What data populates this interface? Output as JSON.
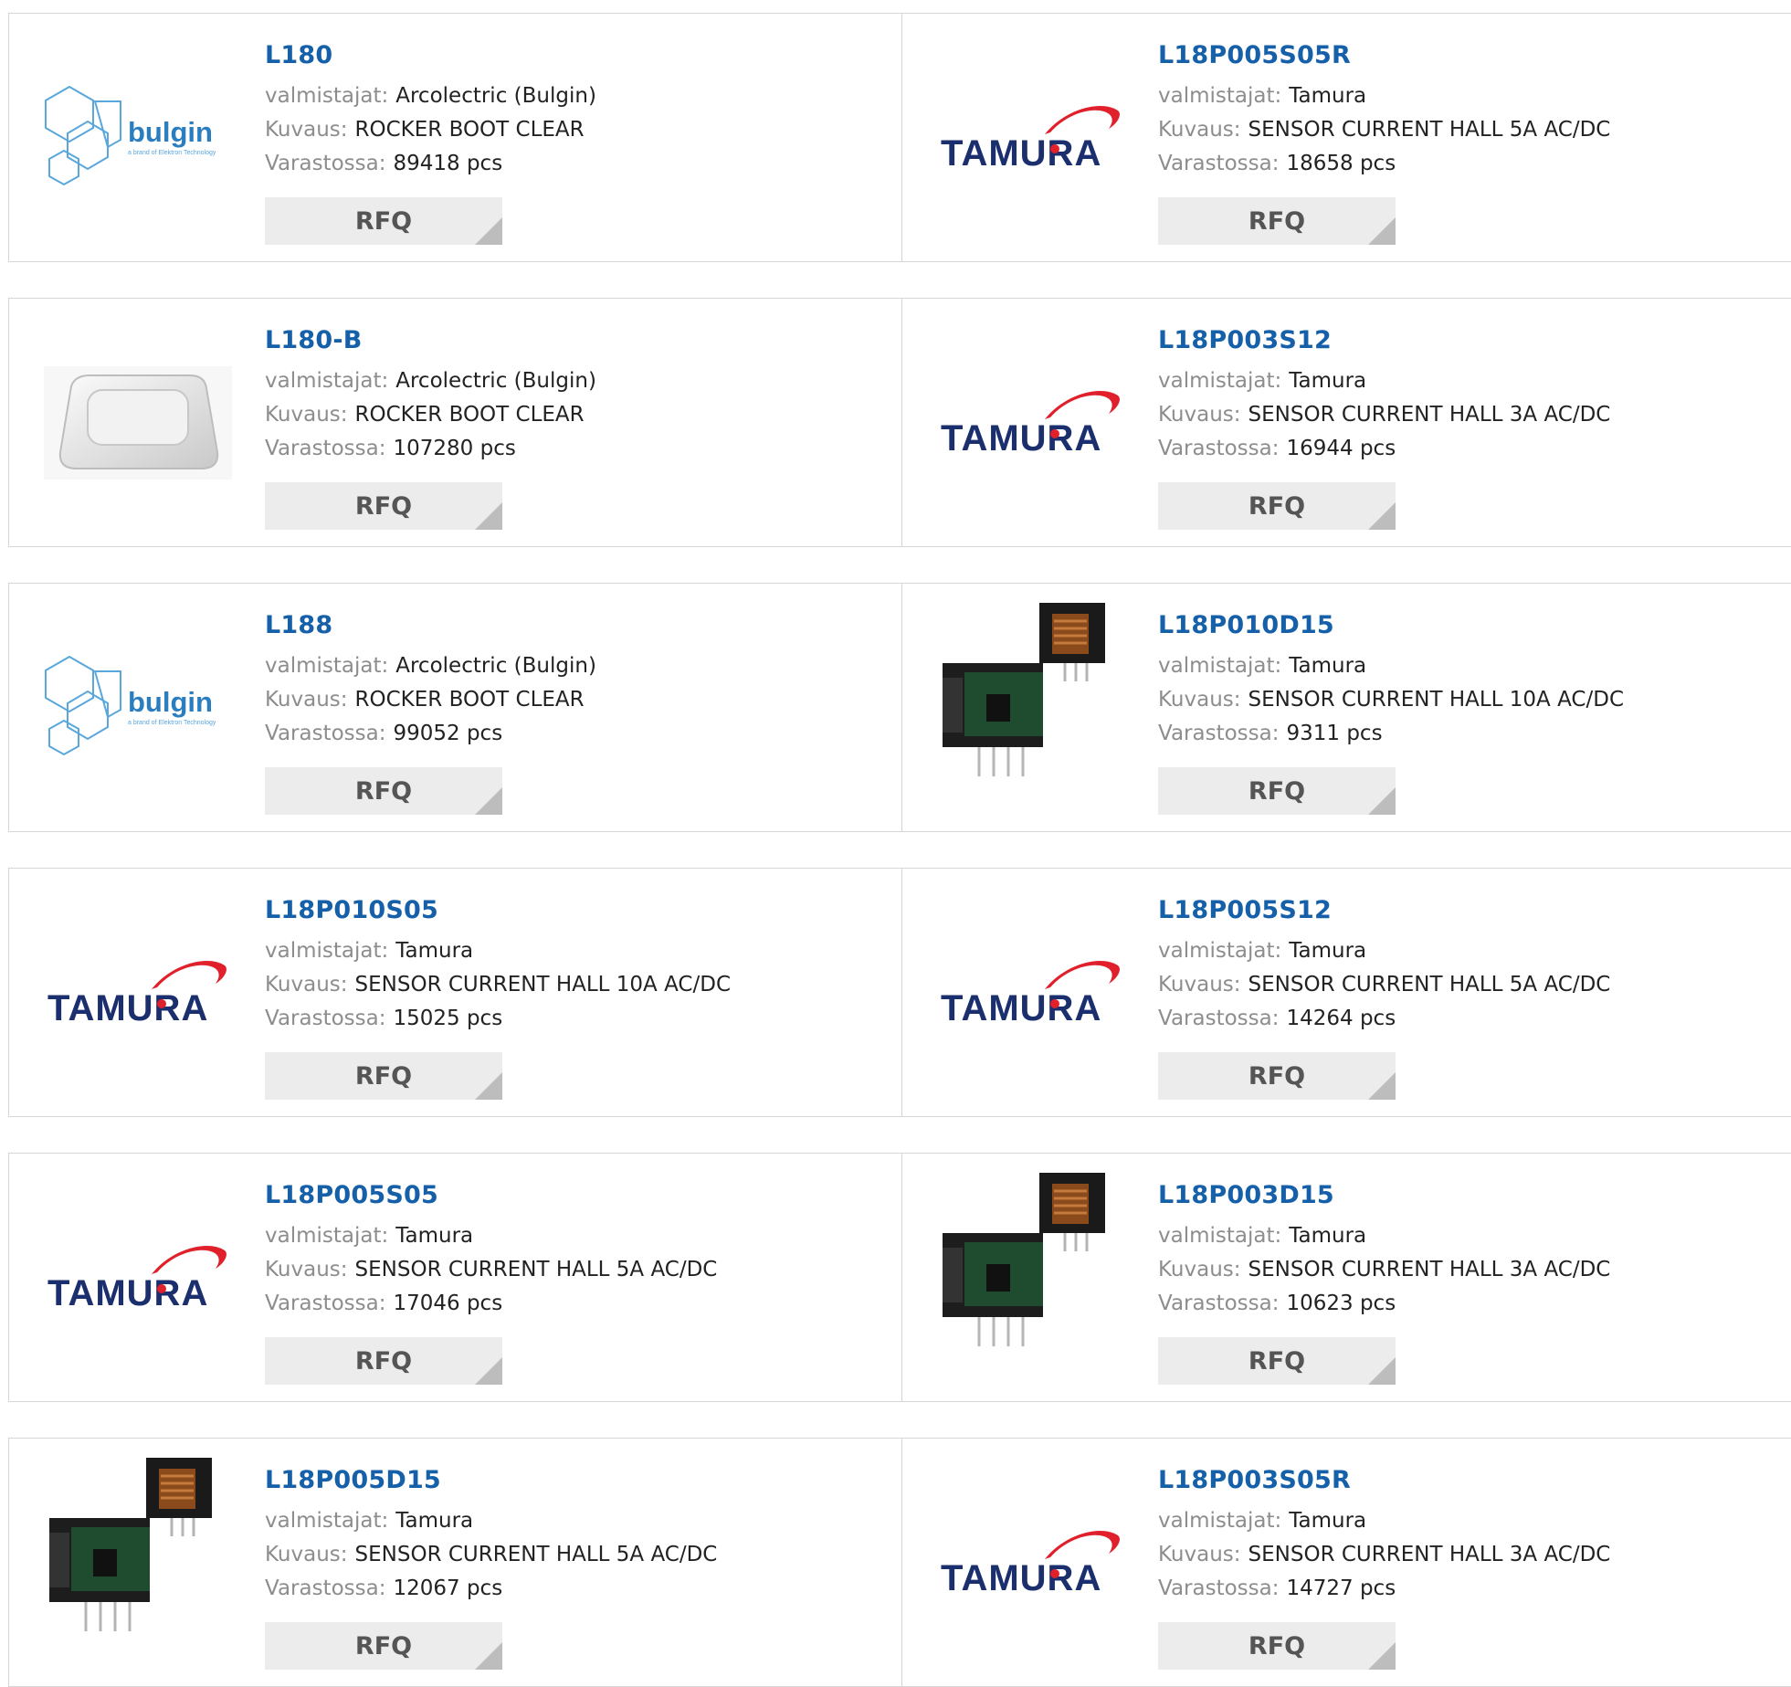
{
  "labels": {
    "manufacturer": "valmistajat:",
    "description": "Kuvaus:",
    "stock": "Varastossa:",
    "rfq": "RFQ"
  },
  "products": [
    {
      "part": "L180",
      "manufacturer": "Arcolectric (Bulgin)",
      "description": "ROCKER BOOT CLEAR",
      "stock": "89418 pcs",
      "image": "bulgin-logo"
    },
    {
      "part": "L18P005S05R",
      "manufacturer": "Tamura",
      "description": "SENSOR CURRENT HALL 5A AC/DC",
      "stock": "18658 pcs",
      "image": "tamura-logo"
    },
    {
      "part": "L180-B",
      "manufacturer": "Arcolectric (Bulgin)",
      "description": "ROCKER BOOT CLEAR",
      "stock": "107280 pcs",
      "image": "clear-boot-photo"
    },
    {
      "part": "L18P003S12",
      "manufacturer": "Tamura",
      "description": "SENSOR CURRENT HALL 3A AC/DC",
      "stock": "16944 pcs",
      "image": "tamura-logo"
    },
    {
      "part": "L188",
      "manufacturer": "Arcolectric (Bulgin)",
      "description": "ROCKER BOOT CLEAR",
      "stock": "99052 pcs",
      "image": "bulgin-logo"
    },
    {
      "part": "L18P010D15",
      "manufacturer": "Tamura",
      "description": "SENSOR CURRENT HALL 10A AC/DC",
      "stock": "9311 pcs",
      "image": "sensor-photo"
    },
    {
      "part": "L18P010S05",
      "manufacturer": "Tamura",
      "description": "SENSOR CURRENT HALL 10A AC/DC",
      "stock": "15025 pcs",
      "image": "tamura-logo"
    },
    {
      "part": "L18P005S12",
      "manufacturer": "Tamura",
      "description": "SENSOR CURRENT HALL 5A AC/DC",
      "stock": "14264 pcs",
      "image": "tamura-logo"
    },
    {
      "part": "L18P005S05",
      "manufacturer": "Tamura",
      "description": "SENSOR CURRENT HALL 5A AC/DC",
      "stock": "17046 pcs",
      "image": "tamura-logo"
    },
    {
      "part": "L18P003D15",
      "manufacturer": "Tamura",
      "description": "SENSOR CURRENT HALL 3A AC/DC",
      "stock": "10623 pcs",
      "image": "sensor-photo"
    },
    {
      "part": "L18P005D15",
      "manufacturer": "Tamura",
      "description": "SENSOR CURRENT HALL 5A AC/DC",
      "stock": "12067 pcs",
      "image": "sensor-photo"
    },
    {
      "part": "L18P003S05R",
      "manufacturer": "Tamura",
      "description": "SENSOR CURRENT HALL 3A AC/DC",
      "stock": "14727 pcs",
      "image": "tamura-logo"
    }
  ],
  "colors": {
    "part_link": "#1560a8",
    "label": "#8d8d8d",
    "value": "#222222",
    "border": "#d6d6d6",
    "rfq_bg": "#ececec",
    "tamura_blue": "#1b2f6e",
    "tamura_red": "#e0202a",
    "bulgin_blue": "#2a7ec0"
  }
}
